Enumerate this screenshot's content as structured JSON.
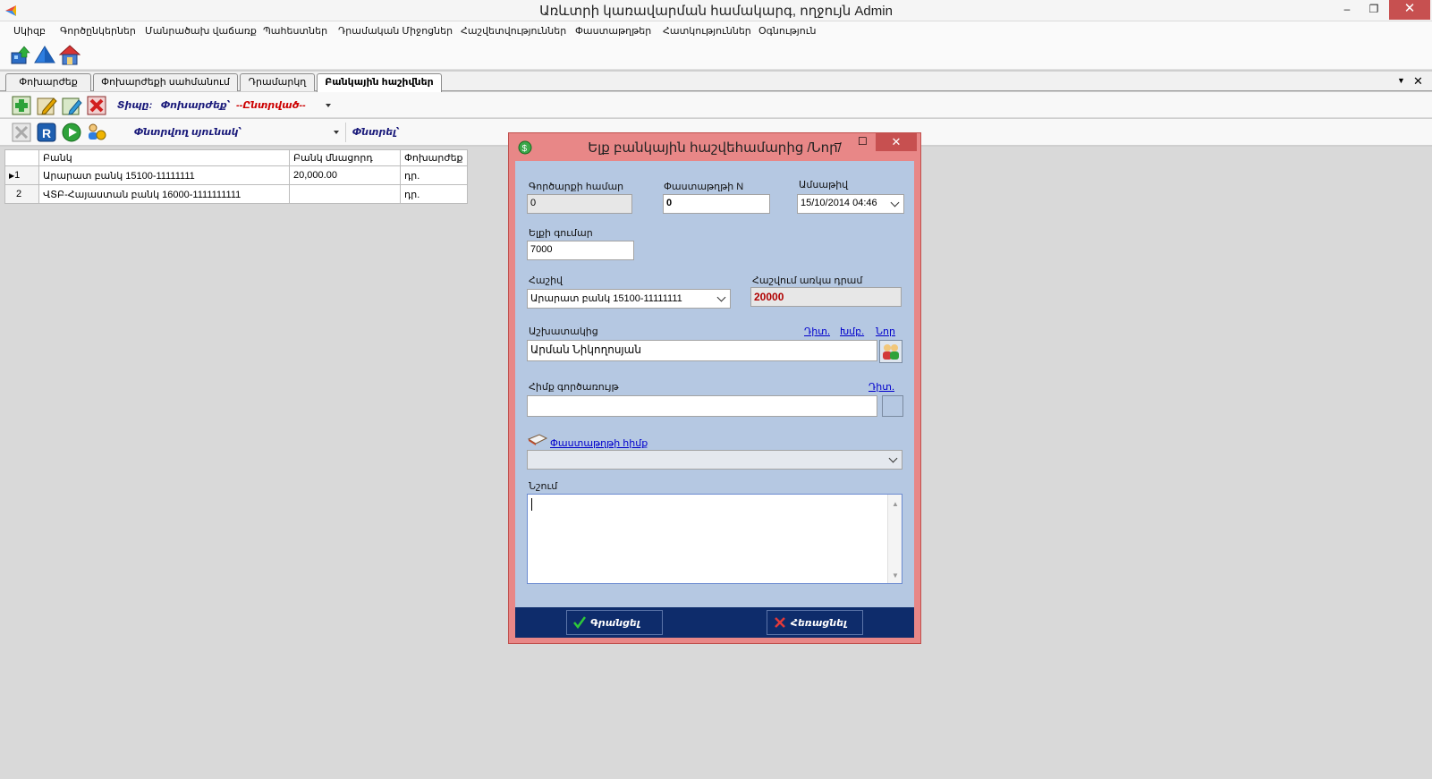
{
  "window": {
    "title": "Առևտրի կառավարման համակարգ, ողջույն Admin",
    "minimize": "–",
    "restore": "❐",
    "close": "✕"
  },
  "menu": [
    "Սկիզբ",
    "Գործընկերներ",
    "Մանրածախ վաճառք",
    "Պահեստներ",
    "Դրամական Միջոցներ",
    "Հաշվետվություններ",
    "Փաստաթղթեր",
    "Հատկություններ",
    "Օգնություն"
  ],
  "tabs": [
    "Փոխարժեք",
    "Փոխարժեքի սահմանում",
    "Դրամարկղ",
    "Բանկային հաշիվներ"
  ],
  "filter": {
    "type_label": "Տիպը:",
    "type_value": "Փոխարժեք՝",
    "selected_value": "--Ընտրված--",
    "search_column_label": "Փնտրվող սյունակ՝",
    "search_label": "Փնտրել՝"
  },
  "grid": {
    "columns": [
      "Բանկ",
      "Բանկ մնացորդ",
      "Փոխարժեք"
    ],
    "rows": [
      {
        "num": "1",
        "bank": "Արարատ բանկ 15100-11111111",
        "balance": "20,000.00",
        "currency": "դր."
      },
      {
        "num": "2",
        "bank": "ՎՏԲ-Հայաստան բանկ 16000-1111111111",
        "balance": "",
        "currency": "դր."
      }
    ]
  },
  "dialog": {
    "title": "Ելք բանկային հաշվեհամարից /Նոր/",
    "op_number_label": "Գործարքի համար",
    "op_number_value": "0",
    "doc_number_label": "Փաստաթղթի N",
    "doc_number_value": "0",
    "date_label": "Ամսաթիվ",
    "date_value": "15/10/2014 04:46",
    "amount_label": "Ելքի գումար",
    "amount_value": "7000",
    "account_label": "Հաշիվ",
    "account_value": "Արարատ բանկ 15100-11111111",
    "balance_label": "Հաշվում առկա դրամ",
    "balance_value": "20000",
    "employee_label": "Աշխատակից",
    "employee_value": "Արման Նիկողոսյան",
    "link_view": "Դիտ.",
    "link_edit": "Խմբ.",
    "link_new": "Նոր",
    "basis_label": "Հիմք գործառույթ",
    "basis_link": "Դիտ.",
    "basis_value": "",
    "doc_basis_label": "Փաստաթղթի հիմք",
    "doc_basis_value": "",
    "note_label": "Նշում",
    "note_value": "",
    "save_button": "Գրանցել",
    "cancel_button": "Հեռացնել"
  },
  "colors": {
    "dialog_frame": "#e88787",
    "dialog_body": "#b5c8e2",
    "dialog_footer": "#0e2c6b",
    "balance_text": "#b00000"
  }
}
